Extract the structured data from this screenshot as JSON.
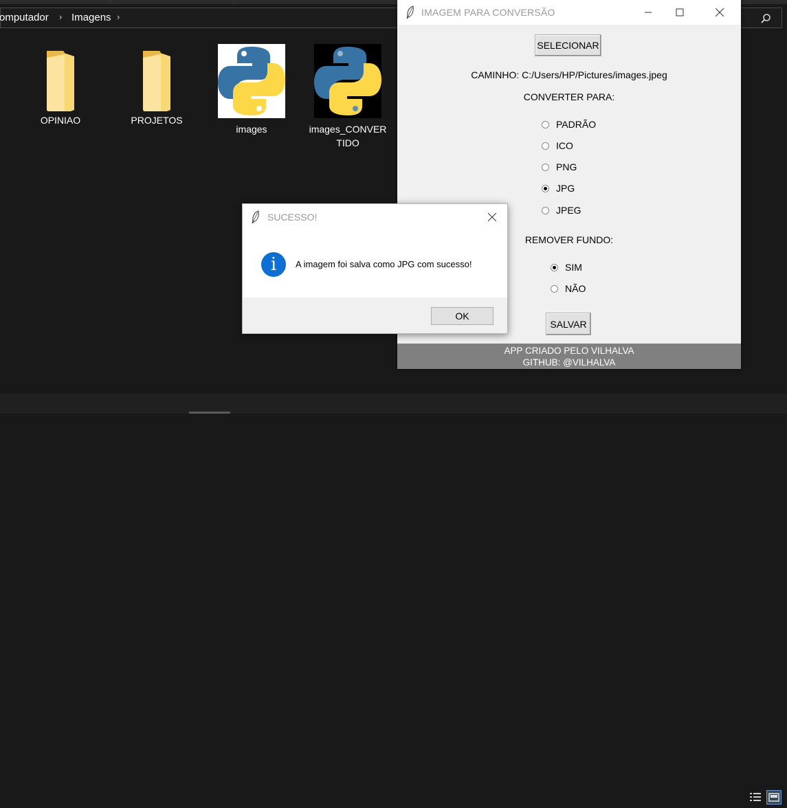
{
  "explorer": {
    "breadcrumb": [
      "omputador",
      "Imagens"
    ],
    "files": [
      {
        "name": "OPINIAO",
        "type": "folder"
      },
      {
        "name": "PROJETOS",
        "type": "folder"
      },
      {
        "name": "images",
        "type": "python-image-white"
      },
      {
        "name": "images_CONVERTIDO",
        "line1": "images_CONVER",
        "line2": "TIDO",
        "type": "python-image-black"
      }
    ],
    "search_icon": "search-icon",
    "view_icons": [
      "details-view-icon",
      "large-icons-view-icon"
    ]
  },
  "main_window": {
    "title": "IMAGEM PARA CONVERSÃO",
    "select_button": "SELECIONAR",
    "path_label": "CAMINHO: C:/Users/HP/Pictures/images.jpeg",
    "convert_label": "CONVERTER PARA:",
    "formats": [
      {
        "label": "PADRÃO",
        "selected": false
      },
      {
        "label": "ICO",
        "selected": false
      },
      {
        "label": "PNG",
        "selected": false
      },
      {
        "label": "JPG",
        "selected": true
      },
      {
        "label": "JPEG",
        "selected": false
      }
    ],
    "remove_bg_label": "REMOVER FUNDO:",
    "remove_bg_options": [
      {
        "label": "SIM",
        "selected": true
      },
      {
        "label": "NÃO",
        "selected": false
      }
    ],
    "save_button": "SALVAR",
    "footer_line1": "APP CRIADO PELO VILHALVA",
    "footer_line2": "GITHUB: @VILHALVA"
  },
  "dialog": {
    "title": "SUCESSO!",
    "message": "A imagem foi salva como JPG com sucesso!",
    "ok_button": "OK",
    "icon": "info-icon"
  },
  "colors": {
    "explorer_bg": "#191919",
    "window_bg": "#f0f0f0",
    "footer_bg": "#808080",
    "info_blue": "#0c6fd1",
    "folder_yellow": "#f8d775"
  }
}
